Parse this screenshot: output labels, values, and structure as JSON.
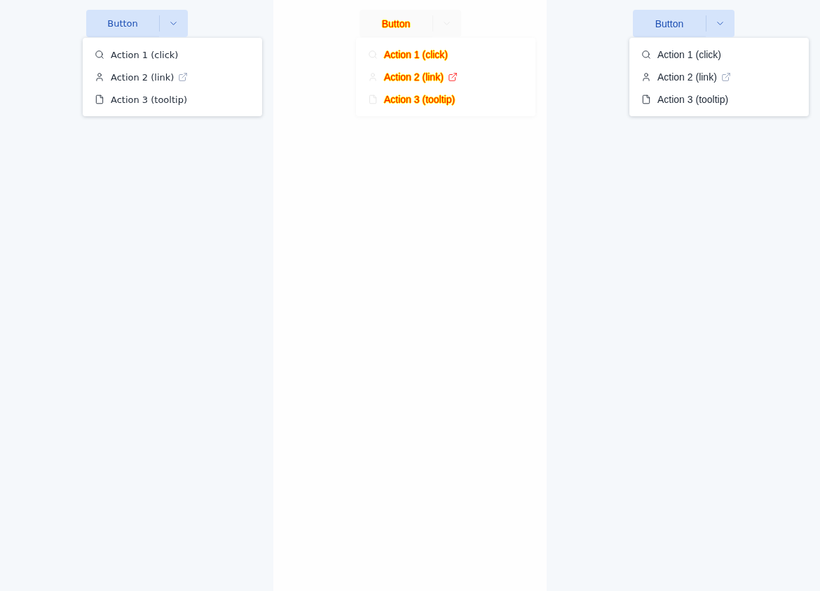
{
  "panels": [
    {
      "kind": "baseline",
      "button": {
        "label": "Button"
      },
      "menu": {
        "items": [
          {
            "label": "Action 1 (click)",
            "external": false
          },
          {
            "label": "Action 2 (link)",
            "external": true
          },
          {
            "label": "Action 3 (tooltip)",
            "external": false
          }
        ]
      }
    },
    {
      "kind": "diff",
      "button": {
        "label": "Button"
      },
      "menu": {
        "items": [
          {
            "label": "Action 1 (click)",
            "external": false
          },
          {
            "label": "Action 2 (link)",
            "external": true
          },
          {
            "label": "Action 3 (tooltip)",
            "external": false
          }
        ]
      }
    },
    {
      "kind": "current",
      "button": {
        "label": "Button"
      },
      "menu": {
        "items": [
          {
            "label": "Action 1 (click)",
            "external": false
          },
          {
            "label": "Action 2 (link)",
            "external": true
          },
          {
            "label": "Action 3 (tooltip)",
            "external": false
          }
        ]
      }
    }
  ]
}
